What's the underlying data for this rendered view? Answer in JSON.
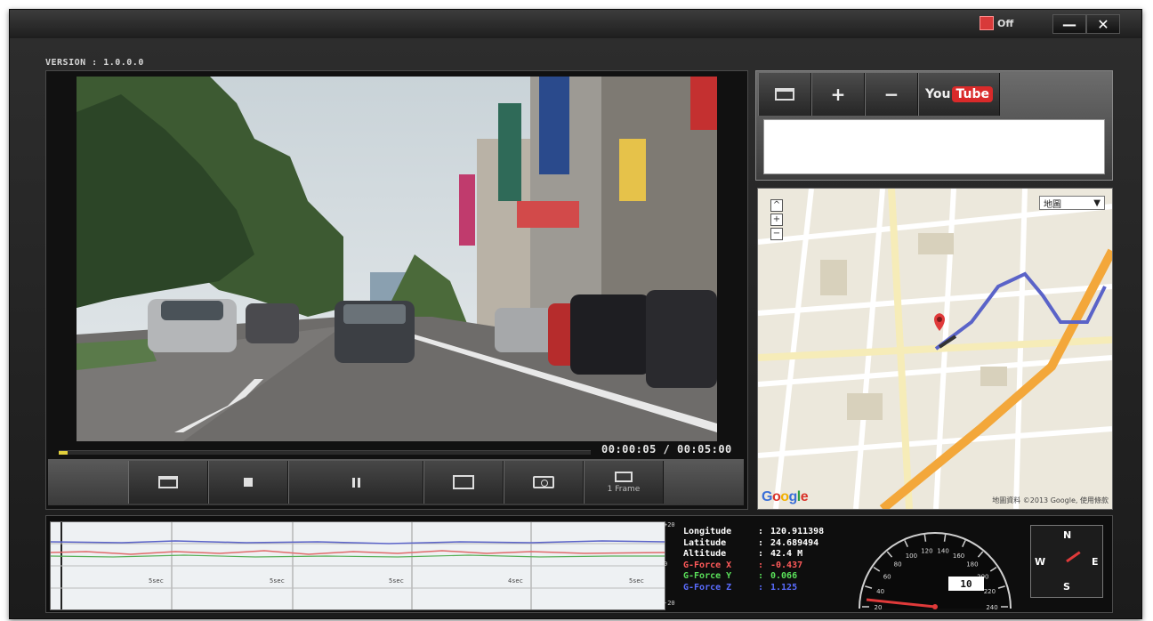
{
  "titlebar": {
    "record_toggle_label": "Off",
    "minimize_label": "—",
    "close_label": "✕"
  },
  "version_text": "VERSION : 1.0.0.0",
  "player": {
    "timecode": "00:00:05 / 00:05:00",
    "progress": 0.017,
    "controls": [
      {
        "name": "open",
        "icon": "folder-icon",
        "label": ""
      },
      {
        "name": "stop",
        "icon": "stop-icon",
        "label": ""
      },
      {
        "name": "pause",
        "icon": "pause-icon",
        "label": ""
      },
      {
        "name": "fullscreen",
        "icon": "fullscreen-icon",
        "label": ""
      },
      {
        "name": "snapshot",
        "icon": "camera-icon",
        "label": ""
      },
      {
        "name": "frame-step",
        "icon": "frame-icon",
        "label": "1 Frame"
      }
    ]
  },
  "share": {
    "buttons": [
      "+",
      "−"
    ],
    "youtube_you": "You",
    "youtube_tube": "Tube"
  },
  "map": {
    "type_selector": "地圖",
    "logo": [
      "G",
      "o",
      "o",
      "g",
      "l",
      "e"
    ],
    "attribution": "地圖資料 ©2013 Google, 使用條款"
  },
  "telemetry": [
    {
      "key": "Longitude",
      "value": "120.911398",
      "color": "#ffffff"
    },
    {
      "key": "Latitude",
      "value": "24.689494",
      "color": "#ffffff"
    },
    {
      "key": "Altitude",
      "value": "42.4 M",
      "color": "#ffffff"
    },
    {
      "key": "G-Force X",
      "value": "-0.437",
      "color": "#ff5a5a"
    },
    {
      "key": "G-Force Y",
      "value": "0.066",
      "color": "#5ae05a"
    },
    {
      "key": "G-Force Z",
      "value": "1.125",
      "color": "#5a6cff"
    }
  ],
  "gsensor": {
    "scale_top": "+20",
    "scale_mid": "0",
    "scale_bottom": "-20",
    "time_labels": [
      "5sec",
      "5sec",
      "5sec",
      "4sec",
      "5sec"
    ]
  },
  "speedometer": {
    "ticks": [
      "20",
      "40",
      "60",
      "80",
      "100",
      "120",
      "140",
      "160",
      "180",
      "200",
      "220",
      "240"
    ],
    "speed": "10"
  },
  "compass": {
    "n": "N",
    "e": "E",
    "s": "S",
    "w": "W",
    "heading_deg": 55
  },
  "colors": {
    "window_bg": "#1f1f1f",
    "progress": "#e2cf3c",
    "route": "#5a63c8",
    "highway": "#f3a73a",
    "needle": "#e03a3a"
  }
}
